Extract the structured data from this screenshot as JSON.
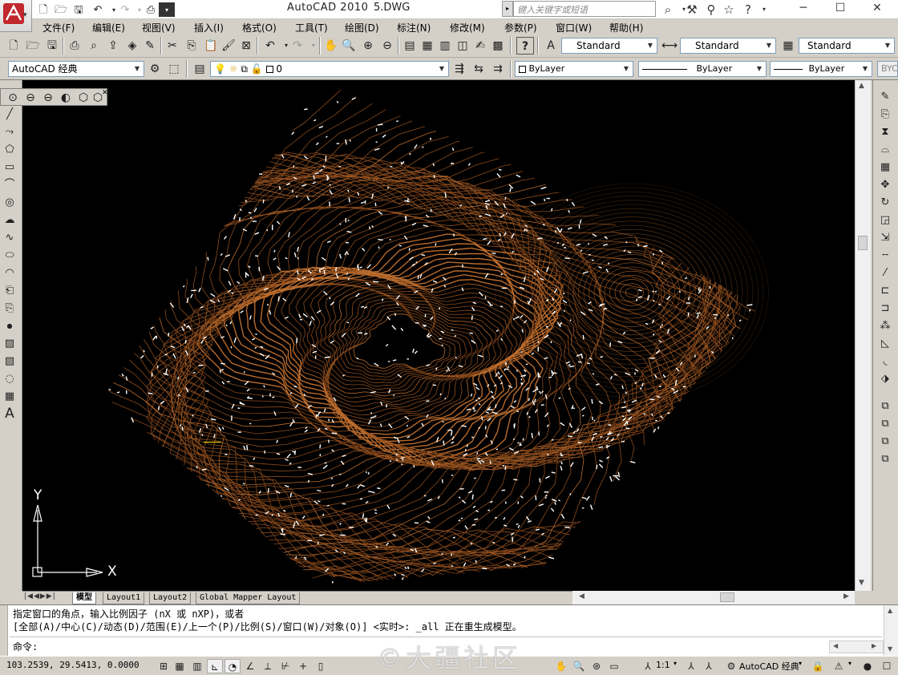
{
  "window": {
    "app_title": "AutoCAD 2010",
    "file_name": "5.DWG",
    "search_placeholder": "键入关键字或短语"
  },
  "menu": [
    "文件(F)",
    "编辑(E)",
    "视图(V)",
    "插入(I)",
    "格式(O)",
    "工具(T)",
    "绘图(D)",
    "标注(N)",
    "修改(M)",
    "参数(P)",
    "窗口(W)",
    "帮助(H)"
  ],
  "styles_toolbar": {
    "text_style": "Standard",
    "dim_style": "Standard",
    "table_style": "Standard"
  },
  "layers_toolbar": {
    "workspace": "AutoCAD 经典",
    "layer": "0",
    "color": "ByLayer",
    "linetype": "ByLayer",
    "lineweight": "ByLayer",
    "plot_style": "BYC"
  },
  "ucs": {
    "y_label": "Y",
    "x_label": "X"
  },
  "tabs": [
    "模型",
    "Layout1",
    "Layout2",
    "Global Mapper Layout"
  ],
  "command": {
    "line1": "指定窗口的角点，输入比例因子 (nX 或 nXP)，或者",
    "line2": "[全部(A)/中心(C)/动态(D)/范围(E)/上一个(P)/比例(S)/窗口(W)/对象(O)] <实时>: _all 正在重生成模型。",
    "prompt": "命令:"
  },
  "status": {
    "coords": "103.2539, 29.5413, 0.0000",
    "annotation_scale": "1:1",
    "workspace": "AutoCAD 经典"
  },
  "watermark": "©大疆社区",
  "colors": {
    "canvas": "#000000",
    "contour": "#8a4a1c",
    "contour_light": "#b86a2c",
    "points": "#ffffff"
  }
}
